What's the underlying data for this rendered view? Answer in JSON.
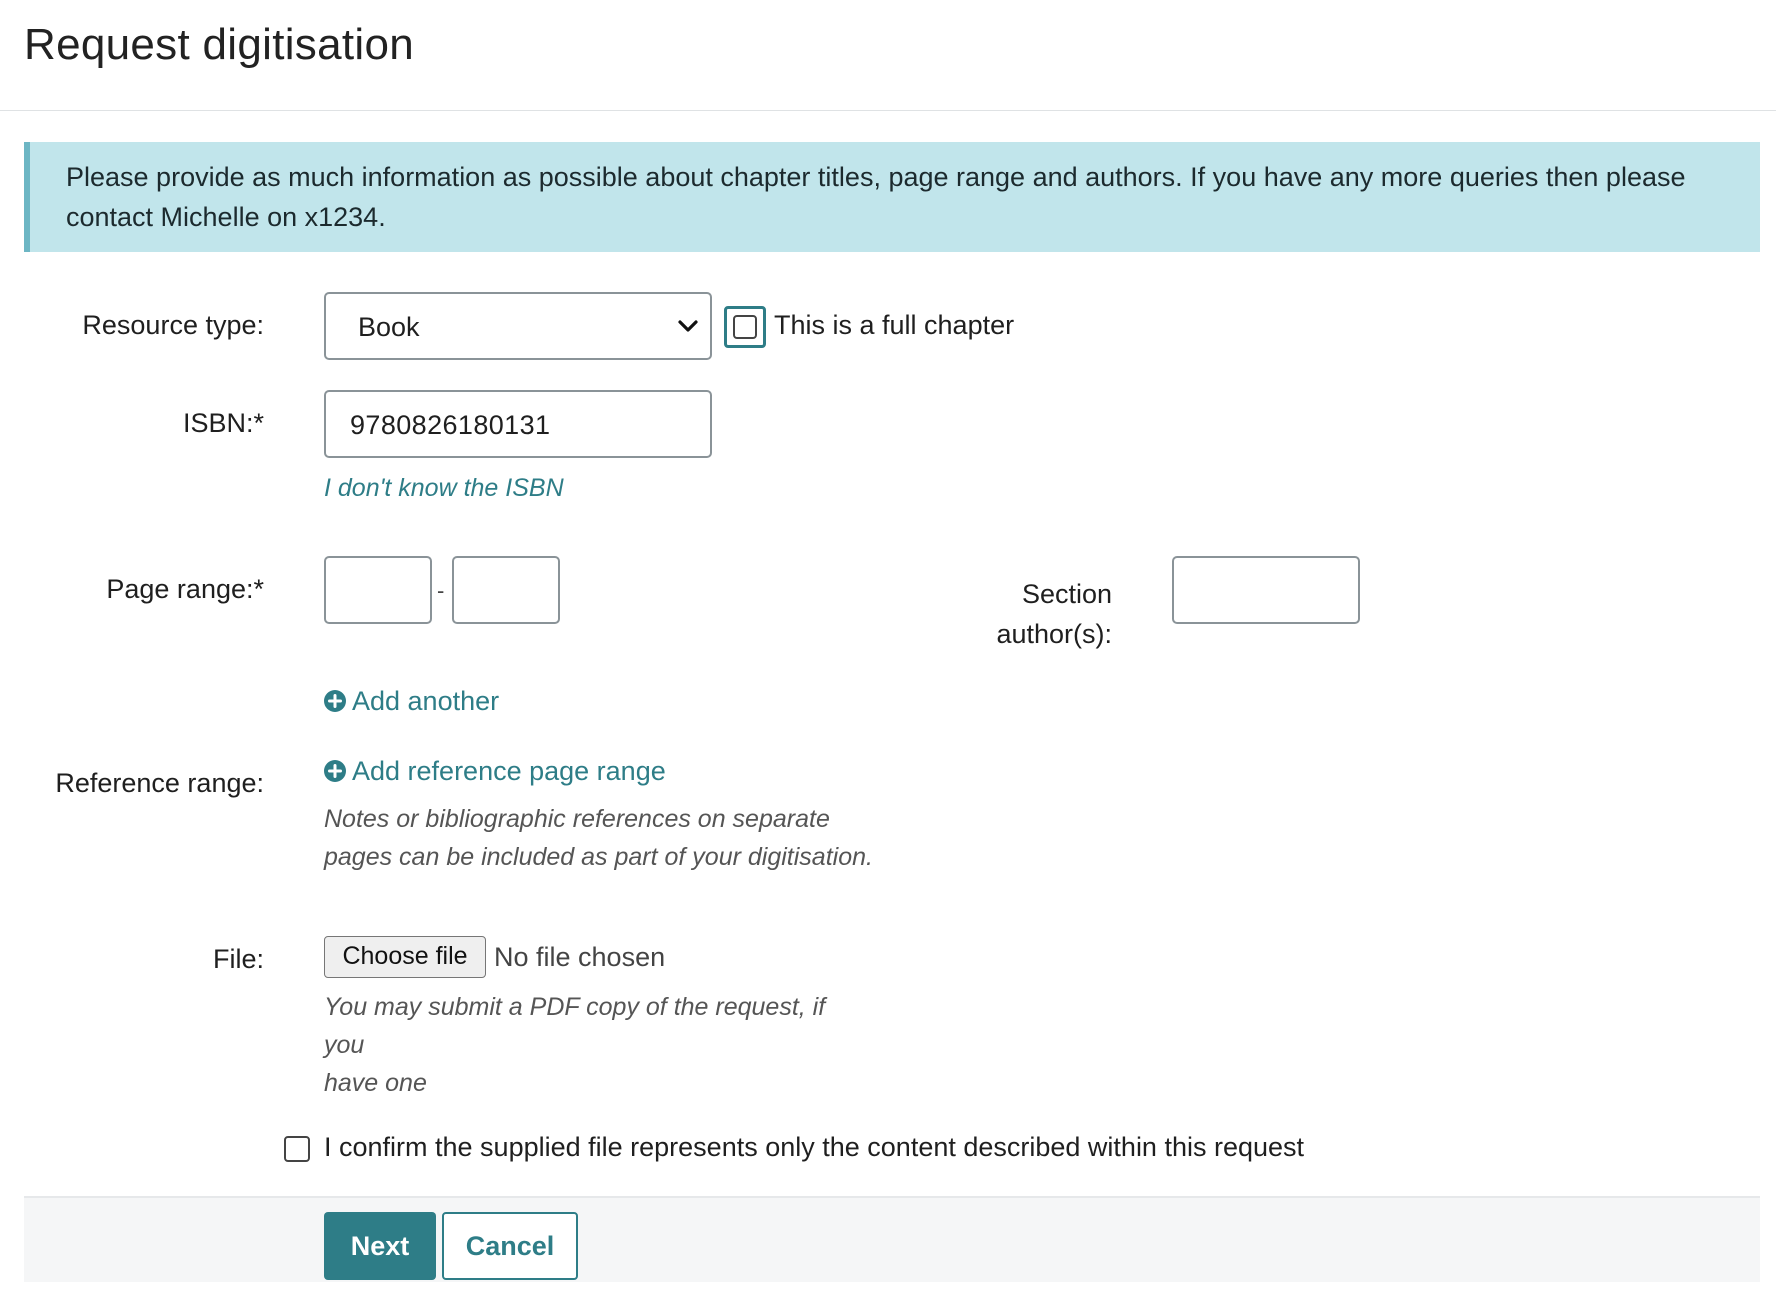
{
  "page": {
    "title": "Request digitisation"
  },
  "notice": {
    "text": "Please provide as much information as possible about chapter titles, page range and authors. If you have any more queries then please contact Michelle on x1234."
  },
  "form": {
    "resource_type": {
      "label": "Resource type:",
      "selected": "Book"
    },
    "full_chapter": {
      "label": "This is a full chapter",
      "checked": false
    },
    "isbn": {
      "label": "ISBN:*",
      "value": "9780826180131",
      "unknown_link": "I don't know the ISBN"
    },
    "page_range": {
      "label": "Page range:*",
      "from": "",
      "to": "",
      "separator": "-",
      "add_another": "Add another"
    },
    "section_authors": {
      "label_line1": "Section",
      "label_line2": "author(s):",
      "value": ""
    },
    "reference_range": {
      "label": "Reference range:",
      "add_link": "Add reference page range",
      "help_line1": "Notes or bibliographic references on separate",
      "help_line2": "pages can be included as part of your digitisation."
    },
    "file": {
      "label": "File:",
      "button": "Choose file",
      "status": "No file chosen",
      "help_line1": "You may submit a PDF copy of the request, if you",
      "help_line2": "have one"
    },
    "confirm": {
      "text": "I confirm the supplied file represents only the content described within this request",
      "checked": false
    }
  },
  "footer": {
    "next": "Next",
    "cancel": "Cancel"
  },
  "colors": {
    "accent": "#2e7d87",
    "notice_bg": "#c1e5eb",
    "notice_border": "#6db6c4"
  },
  "icons": {
    "select_arrow": "chevron-down-icon",
    "add": "plus-circle-icon"
  }
}
